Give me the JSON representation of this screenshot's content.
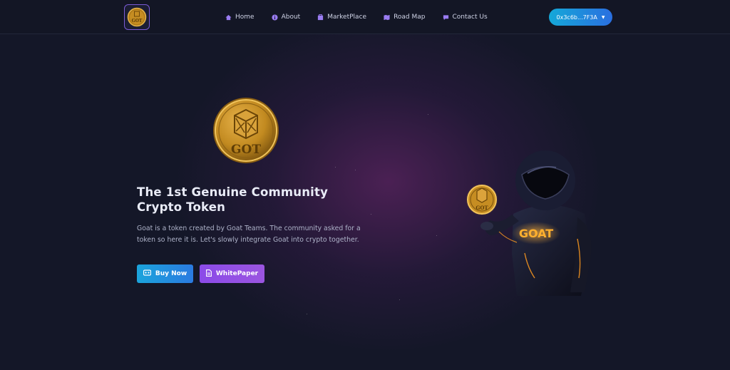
{
  "nav": {
    "logo_text": "GOT",
    "items": [
      {
        "label": "Home",
        "icon": "home-icon"
      },
      {
        "label": "About",
        "icon": "info-icon"
      },
      {
        "label": "MarketPlace",
        "icon": "store-icon"
      },
      {
        "label": "Road Map",
        "icon": "map-icon"
      },
      {
        "label": "Contact Us",
        "icon": "chat-icon"
      }
    ],
    "wallet_label": "0x3c6b...7F3A",
    "accent_color": "#8a5cf0"
  },
  "hero": {
    "coin_text": "GOT",
    "title": "The 1st Genuine Community Crypto Token",
    "description": "Goat is a token created by Goat Teams. The community asked for a token so here it is. Let's slowly integrate Goat into crypto together.",
    "buy_label": "Buy Now",
    "whitepaper_label": "WhitePaper",
    "mascot_coin_text": "GOT",
    "mascot_chest_text": "GOAT"
  }
}
